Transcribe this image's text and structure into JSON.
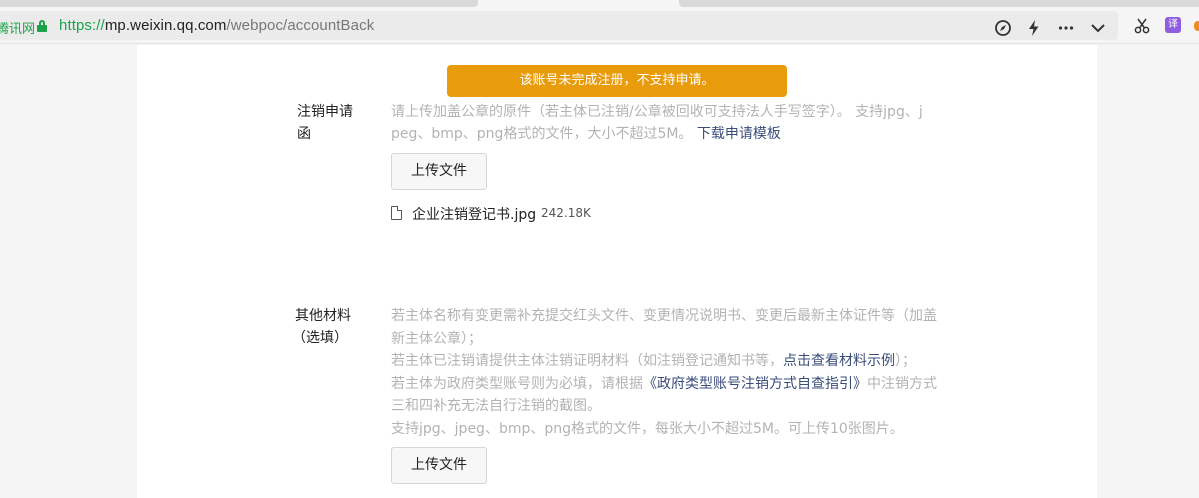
{
  "browser": {
    "site_label": "腾讯网",
    "url_scheme": "https://",
    "url_host": "mp.weixin.qq.com",
    "url_path": "/webpoc/accountBack",
    "translate_badge": "译"
  },
  "alert": {
    "text": "该账号未完成注册，不支持申请。"
  },
  "section_letter": {
    "label_line1": "注销申请",
    "label_line2": "函",
    "desc_line1": "请上传加盖公章的原件（若主体已注销/公章被回收可支持法人手写签字）。 支持jpg、j",
    "desc_line2": "peg、bmp、png格式的文件，大小不超过5M。",
    "template_link": "下载申请模板",
    "upload_button": "上传文件",
    "file_name": "企业注销登记书.jpg",
    "file_size": "242.18K"
  },
  "section_other": {
    "label_line1": "其他材料",
    "label_line2": "（选填）",
    "desc_line1": "若主体名称有变更需补充提交红头文件、变更情况说明书、变更后最新主体证件等（加盖",
    "desc_line2": "新主体公章）；",
    "desc_line3_pre": "若主体已注销请提供主体注销证明材料（如注销登记通知书等，",
    "desc_line3_link": "点击查看材料示例",
    "desc_line3_post": "）；",
    "desc_line4_pre": "若主体为政府类型账号则为必填，请根据",
    "desc_line4_link": "《政府类型账号注销方式自查指引》",
    "desc_line4_post": "中注销方式",
    "desc_line5": "三和四补充无法自行注销的截图。",
    "desc_line6": "支持jpg、jpeg、bmp、png格式的文件，每张大小不超过5M。可上传10张图片。",
    "upload_button": "上传文件"
  }
}
